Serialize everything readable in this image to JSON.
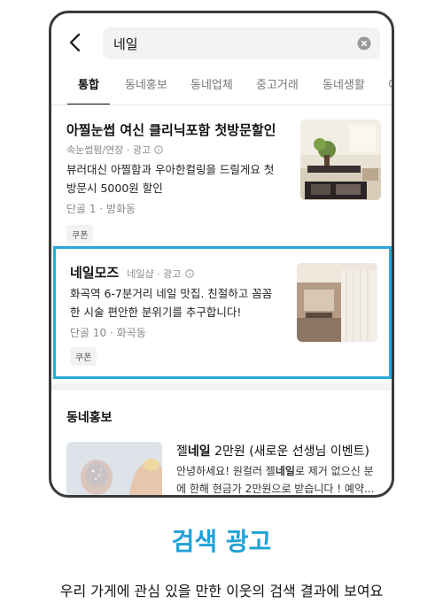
{
  "search": {
    "query": "네일"
  },
  "tabs": [
    "통합",
    "동네홍보",
    "동네업체",
    "중고거래",
    "동네생활",
    "이"
  ],
  "items": [
    {
      "title": "아찔눈썹 여신 클리닉포함 첫방문할인",
      "sub": "속눈썹펌/연장 · 광고",
      "desc_line1": "뷰러대신 아찔함과 우아한컬링을 드릴게요 첫",
      "desc_line2": "방문시 5000원 할인",
      "meta": "단골 1 · 방화동",
      "chip": "쿠폰"
    },
    {
      "title": "네일모즈",
      "sub": "네일샵 · 광고",
      "desc_line1": "화곡역 6-7분거리 네일 맛집. 친절하고 꼼꼼",
      "desc_line2": "한 시술 편안한 분위기를 추구합니다!",
      "meta": "단골 10 · 화곡동",
      "chip": "쿠폰"
    }
  ],
  "promo_section": {
    "title": "동네홍보",
    "item": {
      "title_pre": "젤",
      "title_bold": "네일",
      "title_post": " 2만원 (새로운 선생님 이벤트)",
      "desc1_pre": "안녕하세요! 원컬러 젤",
      "desc1_bold": "네일",
      "desc1_post": "로 제거 없으신 분",
      "desc2": "에 한해 현금가 2만원으로 받습니다 ! 예약..."
    }
  },
  "caption": {
    "title": "검색 광고",
    "subtitle": "우리 가게에 관심 있을 만한 이웃의 검색 결과에 보여요"
  },
  "colors": {
    "accent": "#2aa8d8",
    "caption": "#1fa2d8"
  }
}
